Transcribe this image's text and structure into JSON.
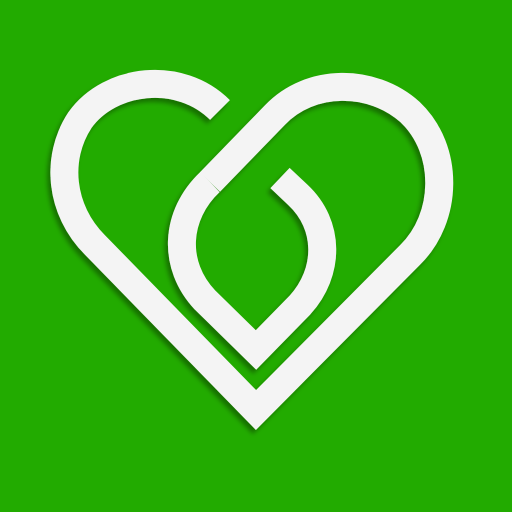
{
  "icon": {
    "name": "heart-leaf-logo",
    "background_color": "#22AB00",
    "stroke_color": "#F4F4F4"
  }
}
